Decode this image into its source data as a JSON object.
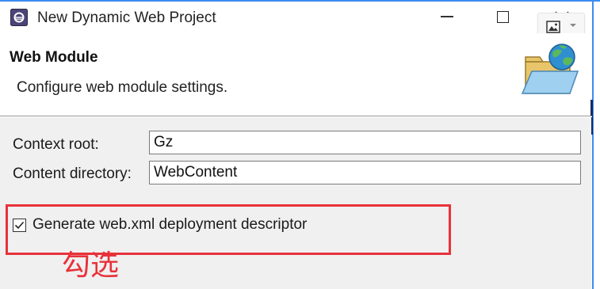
{
  "window": {
    "title": "New Dynamic Web Project",
    "app_icon": "eclipse-icon",
    "controls": [
      "minimize-icon",
      "maximize-icon",
      "close-icon"
    ],
    "overlay_button_icon": "image-icon"
  },
  "header": {
    "title": "Web Module",
    "description": "Configure web module settings.",
    "icon": "folder-globe-icon"
  },
  "form": {
    "context_root": {
      "label": "Context root:",
      "value": "Gz"
    },
    "content_directory": {
      "label": "Content directory:",
      "value": "WebContent"
    },
    "generate_descriptor": {
      "label": "Generate web.xml deployment descriptor",
      "checked": true
    }
  },
  "annotation": {
    "text": "勾选",
    "color": "#e8323a"
  },
  "colors": {
    "accent_border": "#3c8cf0",
    "content_background": "#f0f0f0"
  }
}
